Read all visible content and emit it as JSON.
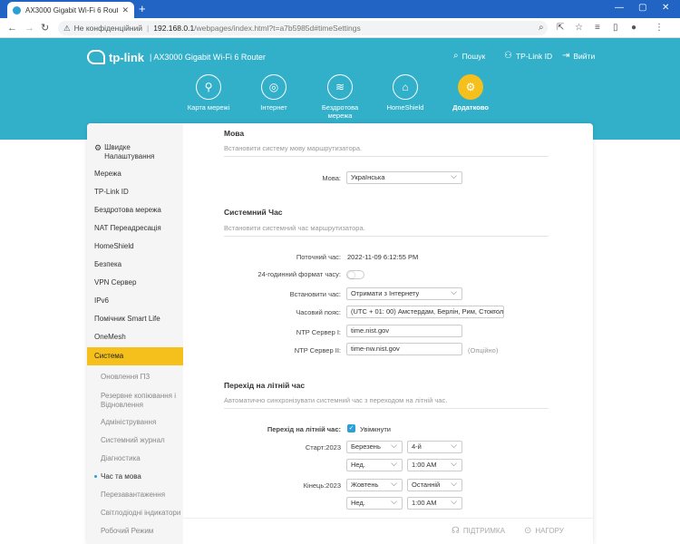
{
  "browser": {
    "tab_title": "AX3000 Gigabit Wi-Fi 6 Router",
    "tab_close": "✕",
    "new_tab": "+",
    "security_label": "Не конфіденційний",
    "url_host": "192.168.0.1",
    "url_path": "/webpages/index.html?t=a7b5985d#timeSettings"
  },
  "header": {
    "brand": "tp-link",
    "model": "AX3000 Gigabit Wi-Fi 6 Router",
    "links": [
      {
        "label": "Пошук",
        "icon": "search-icon"
      },
      {
        "label": "TP-Link ID",
        "icon": "user-icon"
      },
      {
        "label": "Вийти",
        "icon": "logout-icon"
      }
    ],
    "nav": [
      {
        "label": "Карта мережі",
        "icon": "network-map-icon"
      },
      {
        "label": "Інтернет",
        "icon": "globe-icon"
      },
      {
        "label": "Бездротова мережа",
        "icon": "wifi-icon"
      },
      {
        "label": "HomeShield",
        "icon": "homeshield-icon"
      },
      {
        "label": "Додатково",
        "icon": "gear-icon"
      }
    ]
  },
  "sidebar": {
    "items": [
      "Швидке Налаштування",
      "Мережа",
      "TP-Link ID",
      "Бездротова мережа",
      "NAT Переадресація",
      "HomeShield",
      "Безпека",
      "VPN Сервер",
      "IPv6",
      "Помічник Smart Life",
      "OneMesh",
      "Система"
    ],
    "subitems": [
      "Оновлення ПЗ",
      "Резервне копіювання і Відновлення",
      "Адміністрування",
      "Системний журнал",
      "Діагностика",
      "Час та мова",
      "Перезавантаження",
      "Світлодіодні індикатори",
      "Робочий Режим"
    ]
  },
  "language": {
    "title": "Мова",
    "desc": "Встановити систему мову маршрутизатора.",
    "label": "Мова:",
    "value": "Українська"
  },
  "system_time": {
    "title": "Системний Час",
    "desc": "Встановити системний час маршрутизатора.",
    "current_label": "Поточний час:",
    "current_value": "2022-11-09 6:12:55 PM",
    "format_label": "24-годинний формат часу:",
    "format_on": false,
    "set_label": "Встановити час:",
    "set_value": "Отримати з Інтернету",
    "tz_label": "Часовий пояс:",
    "tz_value": "(UTC + 01: 00) Амстердам, Берлін, Рим, Стокгольм",
    "ntp1_label": "NTP Сервер I:",
    "ntp1_value": "time.nist.gov",
    "ntp2_label": "NTP Сервер II:",
    "ntp2_value": "time-nw.nist.gov",
    "optional": "(Опційно)"
  },
  "dst": {
    "title": "Перехід на літній час",
    "desc": "Автоматично синхронізувати системний час з переходом на літній час.",
    "enable_label": "Перехід на літній час:",
    "enable_text": "Увімкнути",
    "start_label": "Старт:2023",
    "start_month": "Березень",
    "start_week": "4-й",
    "start_day": "Нед.",
    "start_time": "1:00 AM",
    "end_label": "Кінець:2023",
    "end_month": "Жовтень",
    "end_week": "Останній",
    "end_day": "Нед.",
    "end_time": "1:00 AM"
  },
  "footer": {
    "support": "ПІДТРИМКА",
    "top": "НАГОРУ"
  }
}
